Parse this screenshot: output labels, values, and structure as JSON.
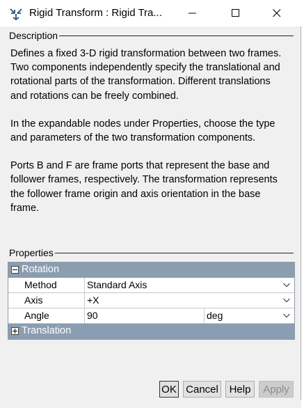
{
  "window": {
    "title": "Rigid Transform : Rigid Tra...",
    "app_icon": "rigid-transform-icon",
    "controls": [
      "minimize-icon",
      "maximize-icon",
      "close-icon"
    ]
  },
  "description": {
    "heading": "Description",
    "paragraphs": [
      "Defines a fixed 3-D rigid transformation between two frames. Two components independently specify the translational and rotational parts of the transformation. Different translations and rotations can be freely combined.",
      "In the expandable nodes under Properties, choose the type and parameters of the two transformation components.",
      "Ports B and F are frame ports that represent the base and follower frames, respectively. The transformation represents the follower frame origin and axis orientation in the base frame."
    ]
  },
  "properties": {
    "heading": "Properties",
    "rotation": {
      "label": "Rotation",
      "expanded": true,
      "method": {
        "label": "Method",
        "value": "Standard Axis"
      },
      "axis": {
        "label": "Axis",
        "value": "+X"
      },
      "angle": {
        "label": "Angle",
        "value": "90",
        "unit": "deg"
      }
    },
    "translation": {
      "label": "Translation",
      "expanded": false
    }
  },
  "buttons": {
    "ok": "OK",
    "cancel": "Cancel",
    "help": "Help",
    "apply": "Apply"
  },
  "colors": {
    "group_header": "#8b9db0",
    "dialog_bg": "#f0f0f0"
  }
}
